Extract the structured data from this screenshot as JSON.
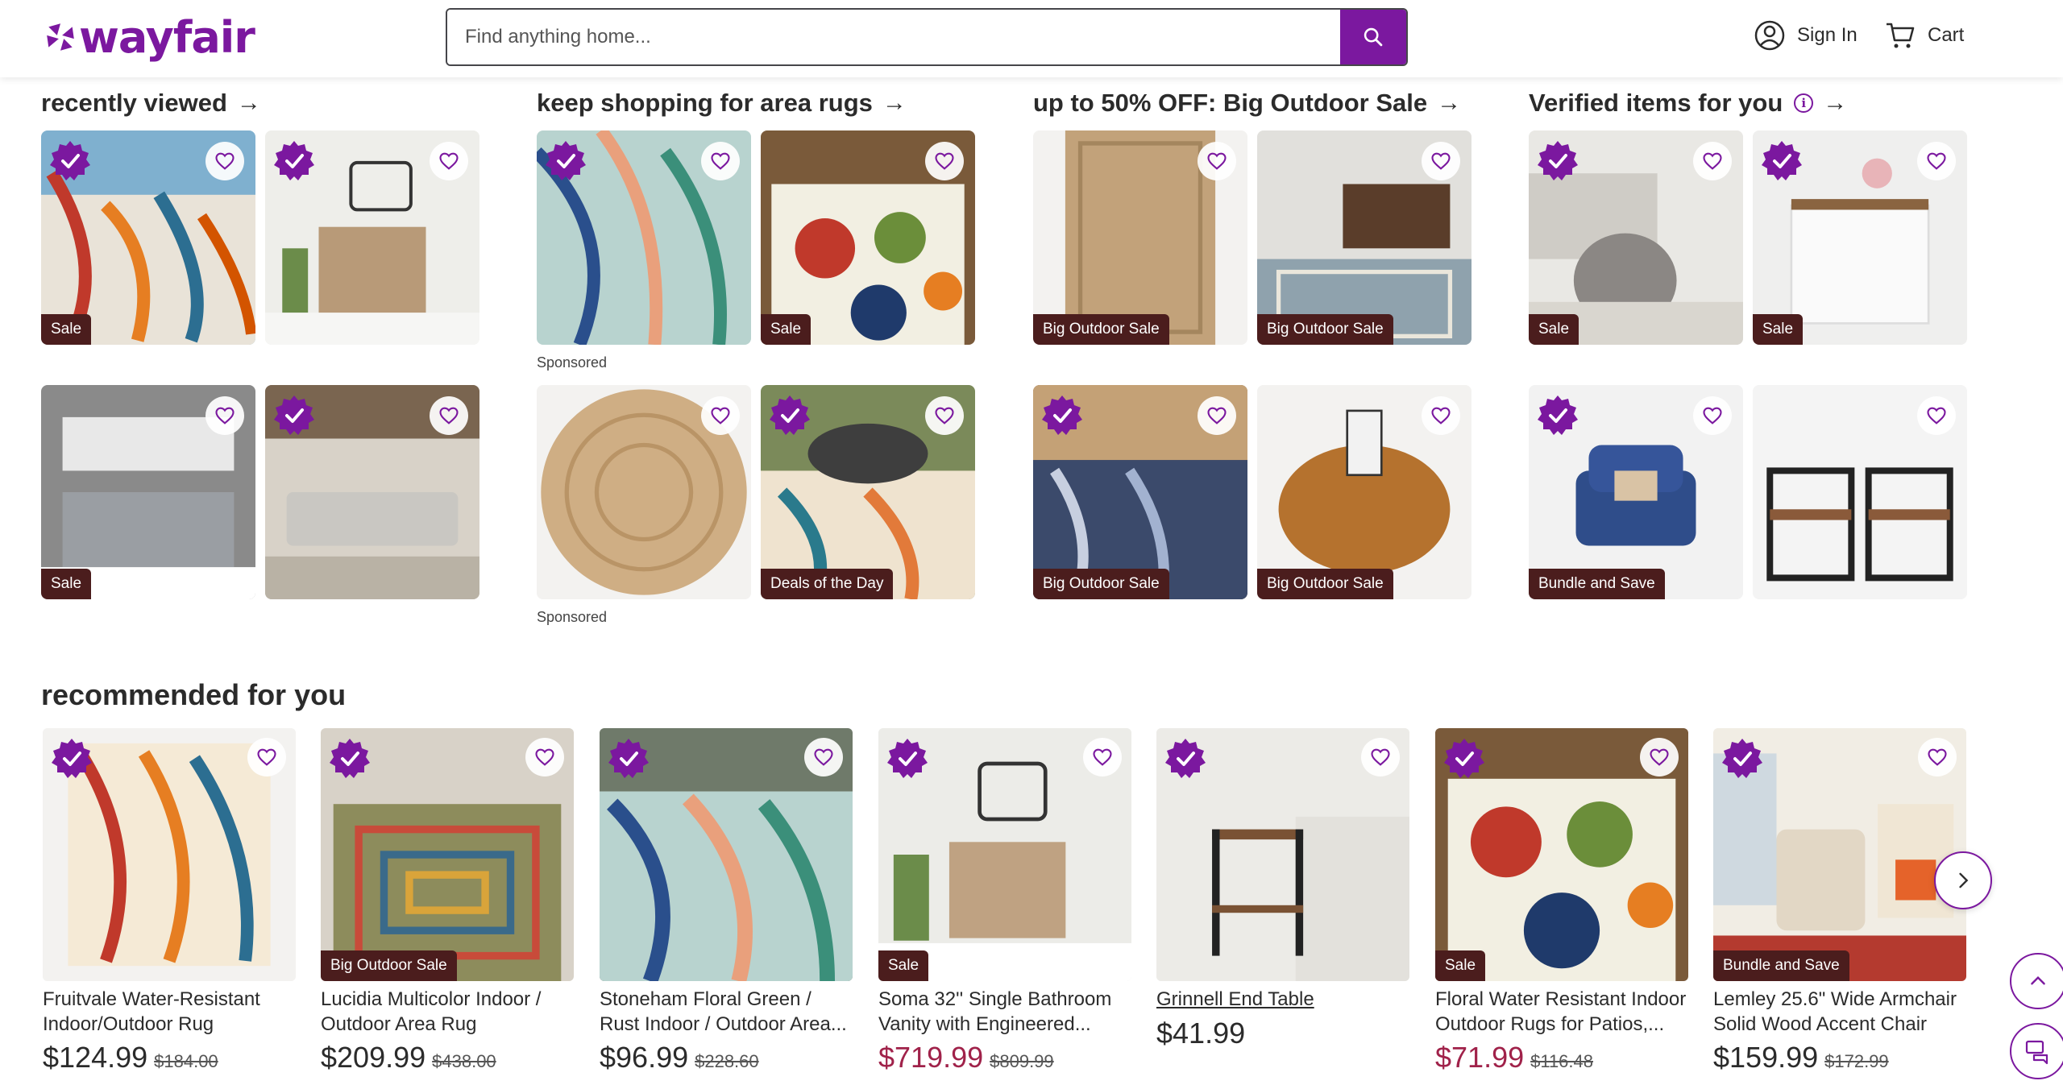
{
  "brand": {
    "name": "wayfair",
    "color": "#7B189F"
  },
  "search": {
    "placeholder": "Find anything home..."
  },
  "header": {
    "sign_in": "Sign In",
    "cart": "Cart"
  },
  "sections": [
    {
      "title": "recently viewed",
      "tiles": [
        {
          "alt": "Floral outdoor rug",
          "badge": "Sale",
          "verified": true
        },
        {
          "alt": "Bathroom vanity",
          "badge": "",
          "verified": true
        },
        {
          "alt": "Double bathroom vanity",
          "badge": "Sale",
          "verified": false
        },
        {
          "alt": "Sectional sofa",
          "badge": "",
          "verified": true
        }
      ]
    },
    {
      "title": "keep shopping for area rugs",
      "tiles": [
        {
          "alt": "Palm leaf rug",
          "badge": "",
          "verified": true
        },
        {
          "alt": "Floral medallion rug",
          "badge": "Sale",
          "verified": false
        },
        {
          "alt": "Round jute rug",
          "badge": "",
          "verified": false
        },
        {
          "alt": "Outdoor palm rug",
          "badge": "Deals of the Day",
          "verified": true
        }
      ],
      "sponsored": [
        "Sponsored",
        "Sponsored"
      ]
    },
    {
      "title": "up to 50% OFF: Big Outdoor Sale",
      "tiles": [
        {
          "alt": "Jute border rug",
          "badge": "Big Outdoor Sale",
          "verified": false
        },
        {
          "alt": "Striped office rug",
          "badge": "Big Outdoor Sale",
          "verified": false
        },
        {
          "alt": "Blue palm outdoor rug",
          "badge": "Big Outdoor Sale",
          "verified": true
        },
        {
          "alt": "Wooden plant caddy",
          "badge": "Big Outdoor Sale",
          "verified": false
        }
      ]
    },
    {
      "title": "Verified items for you",
      "tiles": [
        {
          "alt": "Knit pouf",
          "badge": "Sale",
          "verified": true
        },
        {
          "alt": "White cabinet",
          "badge": "Sale",
          "verified": true
        },
        {
          "alt": "Blue armchair",
          "badge": "Bundle and Save",
          "verified": true
        },
        {
          "alt": "End tables set",
          "badge": "",
          "verified": false
        }
      ]
    }
  ],
  "recommended": {
    "title": "recommended for you",
    "items": [
      {
        "name": "Fruitvale Water-Resistant Indoor/Outdoor Rug",
        "price": "$124.99",
        "was": "$184.00",
        "badge": "",
        "on_sale": false
      },
      {
        "name": "Lucidia Multicolor Indoor / Outdoor Area Rug",
        "price": "$209.99",
        "was": "$438.00",
        "badge": "Big Outdoor Sale",
        "on_sale": false
      },
      {
        "name": "Stoneham Floral Green / Rust Indoor / Outdoor Area...",
        "price": "$96.99",
        "was": "$228.60",
        "badge": "",
        "on_sale": false
      },
      {
        "name": "Soma 32'' Single Bathroom Vanity with Engineered...",
        "price": "$719.99",
        "was": "$809.99",
        "badge": "Sale",
        "on_sale": true
      },
      {
        "name": "Grinnell End Table",
        "price": "$41.99",
        "was": "",
        "badge": "",
        "on_sale": false
      },
      {
        "name": "Floral Water Resistant Indoor Outdoor Rugs for Patios,...",
        "price": "$71.99",
        "was": "$116.48",
        "badge": "Sale",
        "on_sale": true
      },
      {
        "name": "Lemley 25.6\" Wide Armchair Solid Wood Accent Chair",
        "price": "$159.99",
        "was": "$172.99",
        "badge": "Bundle and Save",
        "on_sale": false
      }
    ]
  }
}
